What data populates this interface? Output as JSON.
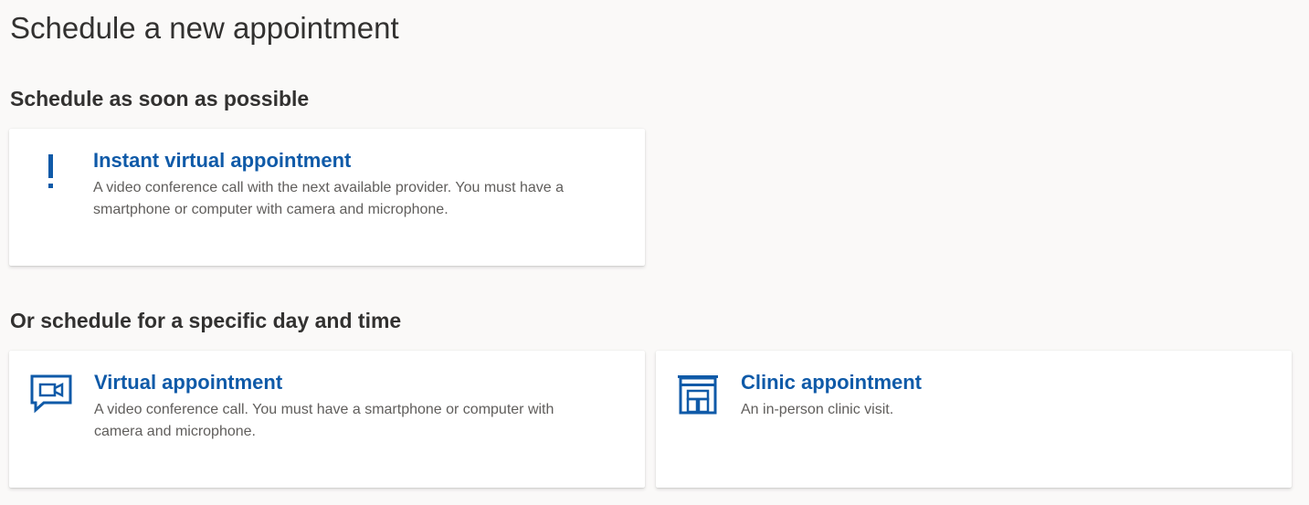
{
  "page": {
    "title": "Schedule a new appointment"
  },
  "sections": [
    {
      "heading": "Schedule as soon as possible",
      "cards": [
        {
          "icon": "exclamation-icon",
          "title": "Instant virtual appointment",
          "description": "A video conference call with the next available provider. You must have a smartphone or computer with camera and microphone."
        }
      ]
    },
    {
      "heading": "Or schedule for a specific day and time",
      "cards": [
        {
          "icon": "video-chat-icon",
          "title": "Virtual appointment",
          "description": "A video conference call. You must have a smartphone or computer with camera and microphone."
        },
        {
          "icon": "clinic-building-icon",
          "title": "Clinic appointment",
          "description": "An in-person clinic visit."
        }
      ]
    }
  ],
  "colors": {
    "background": "#faf9f8",
    "card_background": "#ffffff",
    "accent": "#0f5aa8",
    "text_primary": "#323130",
    "text_secondary": "#605e5c"
  }
}
